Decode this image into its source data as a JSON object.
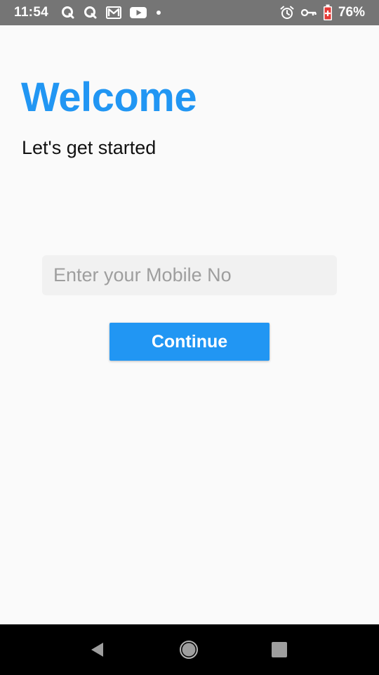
{
  "status_bar": {
    "time": "11:54",
    "left_icons": [
      "q-app-icon",
      "q-app-icon",
      "gmail-icon",
      "youtube-icon",
      "dot-icon"
    ],
    "right_icons": [
      "alarm-icon",
      "vpn-key-icon",
      "battery-saver-icon"
    ],
    "battery_percent": "76%"
  },
  "main": {
    "title": "Welcome",
    "subtitle": "Let's get started",
    "mobile_input": {
      "value": "",
      "placeholder": "Enter your Mobile No"
    },
    "continue_label": "Continue"
  },
  "navigation": {
    "buttons": [
      "back-icon",
      "home-icon",
      "recents-icon"
    ]
  },
  "colors": {
    "accent": "#2196f3",
    "status_bar": "#757575",
    "background": "#fafafa",
    "input_background": "#f1f1f1",
    "nav_bar": "#000000"
  }
}
